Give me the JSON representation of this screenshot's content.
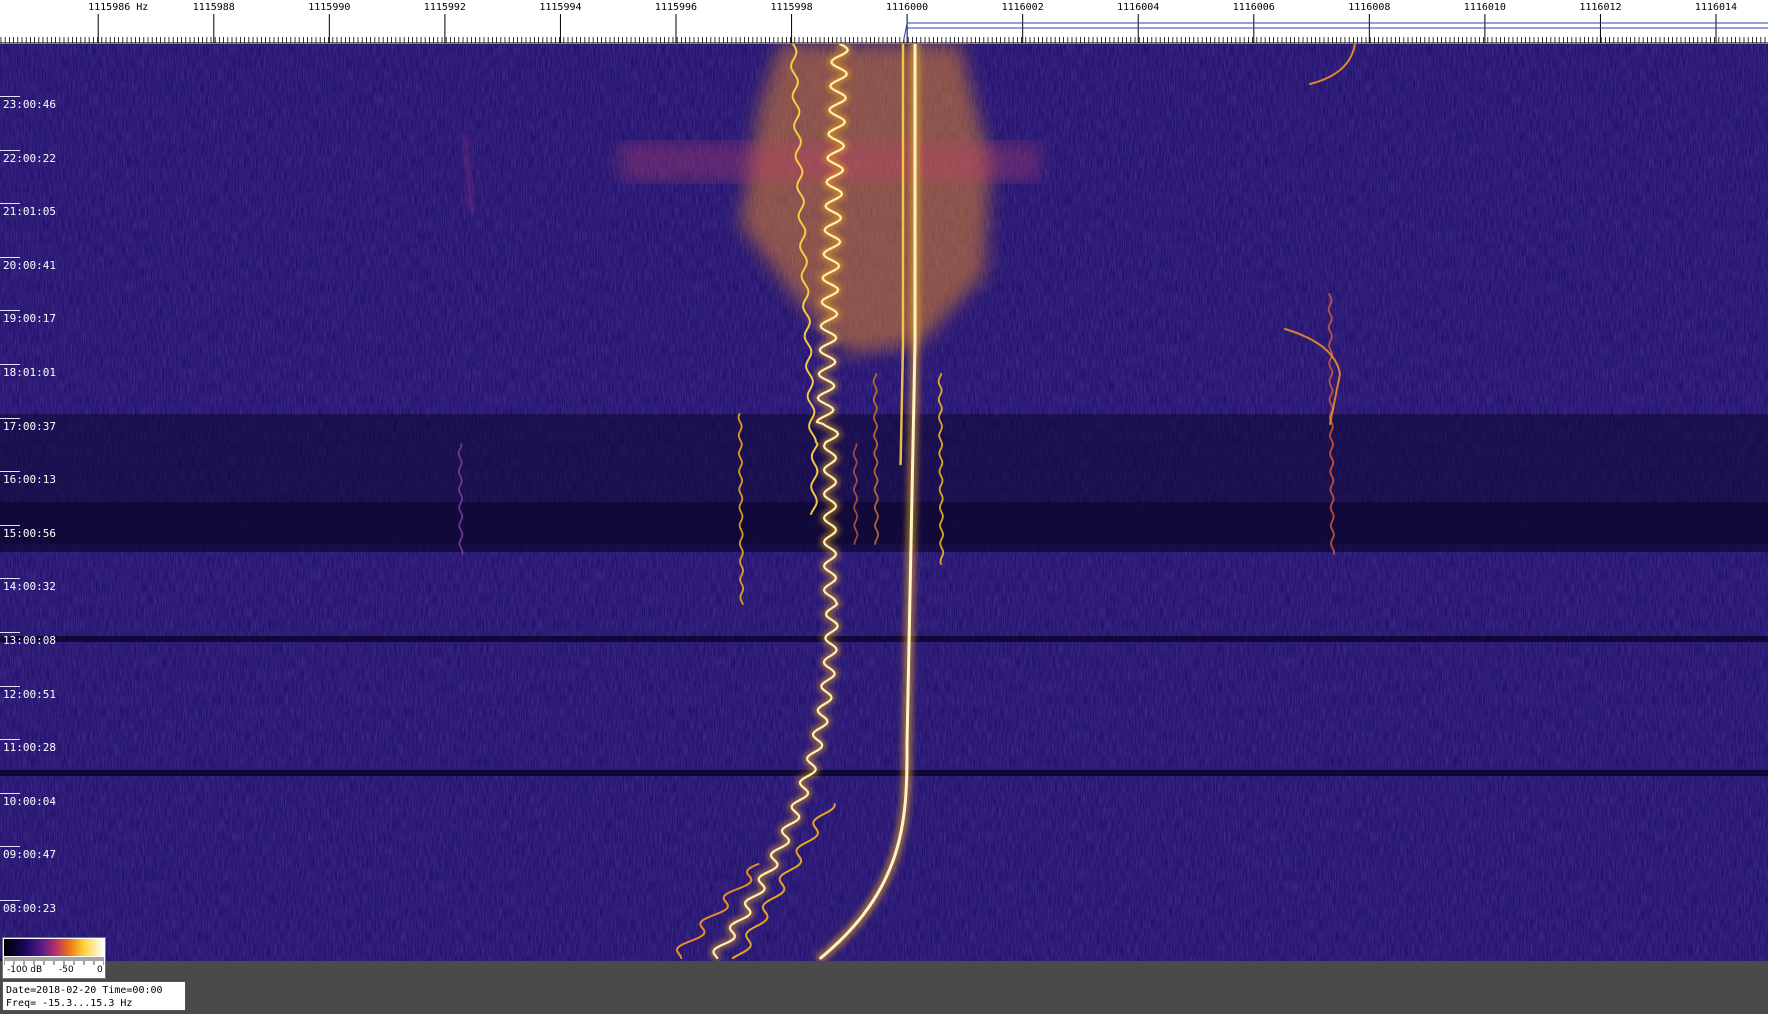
{
  "frequency_axis": {
    "labels": [
      {
        "value": 1115986,
        "text": "1115986 Hz"
      },
      {
        "value": 1115988,
        "text": "1115988"
      },
      {
        "value": 1115990,
        "text": "1115990"
      },
      {
        "value": 1115992,
        "text": "1115992"
      },
      {
        "value": 1115994,
        "text": "1115994"
      },
      {
        "value": 1115996,
        "text": "1115996"
      },
      {
        "value": 1115998,
        "text": "1115998"
      },
      {
        "value": 1116000,
        "text": "1116000"
      },
      {
        "value": 1116002,
        "text": "1116002"
      },
      {
        "value": 1116004,
        "text": "1116004"
      },
      {
        "value": 1116006,
        "text": "1116006"
      },
      {
        "value": 1116008,
        "text": "1116008"
      },
      {
        "value": 1116010,
        "text": "1116010"
      },
      {
        "value": 1116012,
        "text": "1116012"
      },
      {
        "value": 1116014,
        "text": "1116014"
      }
    ],
    "min_hz": 1115984.3,
    "max_hz": 1116014.9,
    "marker_hz": 1116000
  },
  "time_axis": {
    "labels": [
      "23:00:46",
      "22:00:22",
      "21:01:05",
      "20:00:41",
      "19:00:17",
      "18:01:01",
      "17:00:37",
      "16:00:13",
      "15:00:56",
      "14:00:32",
      "13:00:08",
      "12:00:51",
      "11:00:28",
      "10:00:04",
      "09:00:47",
      "08:00:23"
    ]
  },
  "colorbar": {
    "labels": [
      "-100 dB",
      "-50",
      "0"
    ],
    "min_db": -100,
    "max_db": 0
  },
  "info": {
    "line1": "Date=2018-02-20 Time=00:00",
    "line2": "Freq= -15.3...15.3 Hz"
  },
  "colors": {
    "background": "#20116b",
    "dark_band": "#0d0731",
    "signal_core": "#fffbe6",
    "signal_glow": "#ffc21a",
    "strip": "#4a4a4a"
  }
}
